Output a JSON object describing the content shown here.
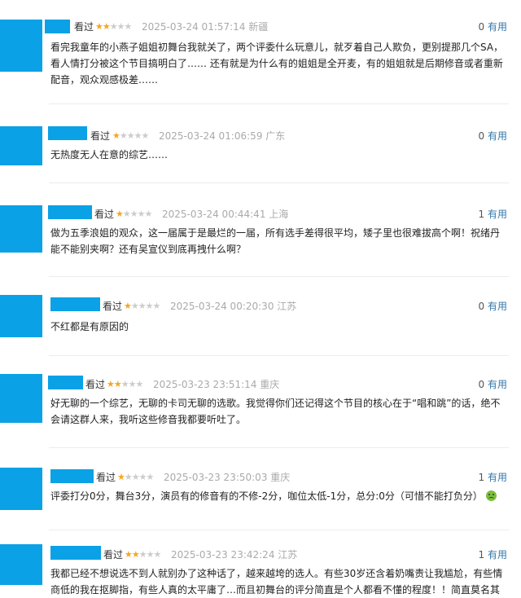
{
  "comments": [
    {
      "status": "看过",
      "stars": 2,
      "time": "2025-03-24 01:57:14",
      "region": "新疆",
      "count": "0",
      "useful": "有用",
      "text": "看完我童年的小燕子姐姐初舞台我就关了，两个评委什么玩意儿，就歹着自己人欺负，更别提那几个SA，看人情打分被这个节目搞明白了…… 还有就是为什么有的姐姐是全开麦，有的姐姐就是后期修音或者重新配音，观众观感极差……"
    },
    {
      "status": "看过",
      "stars": 1,
      "time": "2025-03-24 01:06:59",
      "region": "广东",
      "count": "0",
      "useful": "有用",
      "text": "无热度无人在意的综艺……"
    },
    {
      "status": "看过",
      "stars": 1,
      "time": "2025-03-24 00:44:41",
      "region": "上海",
      "count": "1",
      "useful": "有用",
      "text": "做为五季浪姐的观众，这一届属于是最烂的一届，所有选手差得很平均，矮子里也很难拔高个啊！祝绪丹能不能别夹啊？还有吴宣仪到底再拽什么啊？"
    },
    {
      "status": "看过",
      "stars": 1,
      "time": "2025-03-24 00:20:30",
      "region": "江苏",
      "count": "0",
      "useful": "有用",
      "text": "不红都是有原因的"
    },
    {
      "status": "看过",
      "stars": 2,
      "time": "2025-03-23 23:51:14",
      "region": "重庆",
      "count": "0",
      "useful": "有用",
      "text": "好无聊的一个综艺，无聊的卡司无聊的选歌。我觉得你们还记得这个节目的核心在于“唱和跳”的话，绝不会请这群人来，我听这些修音我都要听吐了。"
    },
    {
      "status": "看过",
      "stars": 1,
      "time": "2025-03-23 23:50:03",
      "region": "重庆",
      "count": "1",
      "useful": "有用",
      "text": "评委打分0分，舞台3分，演员有的修音有的不修-2分，咖位太低-1分，总分:0分（可惜不能打负分）"
    },
    {
      "status": "看过",
      "stars": 2,
      "time": "2025-03-23 23:42:24",
      "region": "江苏",
      "count": "1",
      "useful": "有用",
      "text": "我都已经不想说选不到人就别办了这种话了，越来越垮的选人。有些30岁还含着奶嘴责让我尴尬，有些情商低的我在抠脚指，有些人真的太平庸了…而且初舞台的评分简直是个人都看不懂的程度！！简直莫名其"
    }
  ]
}
